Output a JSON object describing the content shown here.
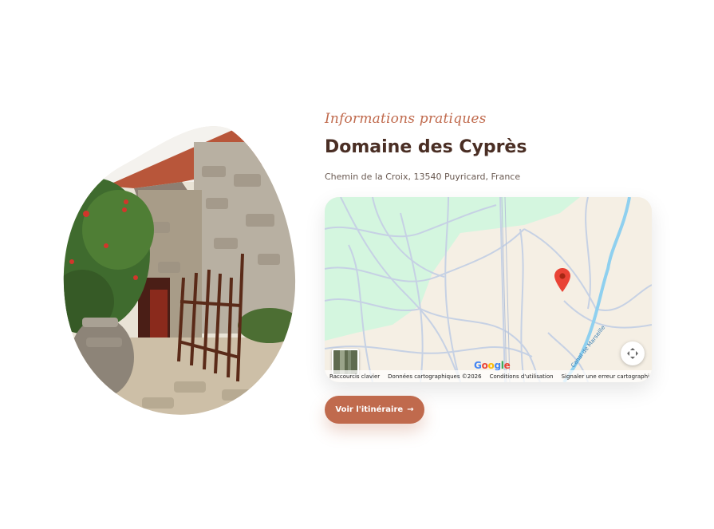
{
  "section": {
    "kicker": "Informations pratiques",
    "title": "Domaine des Cyprès",
    "address": "Chemin de la Croix, 13540 Puyricard, France"
  },
  "map": {
    "water_label": "Canal de Marseille",
    "logo_letters": [
      "G",
      "o",
      "o",
      "g",
      "l",
      "e"
    ],
    "attribution": {
      "shortcuts": "Raccourcis clavier",
      "data": "Données cartographiques ©2026",
      "terms": "Conditions d'utilisation",
      "report": "Signaler une erreur cartographique"
    },
    "colors": {
      "land": "#f5efe4",
      "park": "#d4f6df",
      "roads": "#c6d1e4",
      "water": "#8fd0ef",
      "pin": "#e94335"
    }
  },
  "cta": {
    "label": "Voir l'itinéraire",
    "arrow": "→"
  },
  "icons": {
    "pin": "map-pin-icon",
    "fullscreen": "fullscreen-icon",
    "arrow": "arrow-right-icon"
  },
  "colors": {
    "accent": "#c06a4d",
    "heading": "#4a2e24",
    "text": "#6a5a52"
  }
}
